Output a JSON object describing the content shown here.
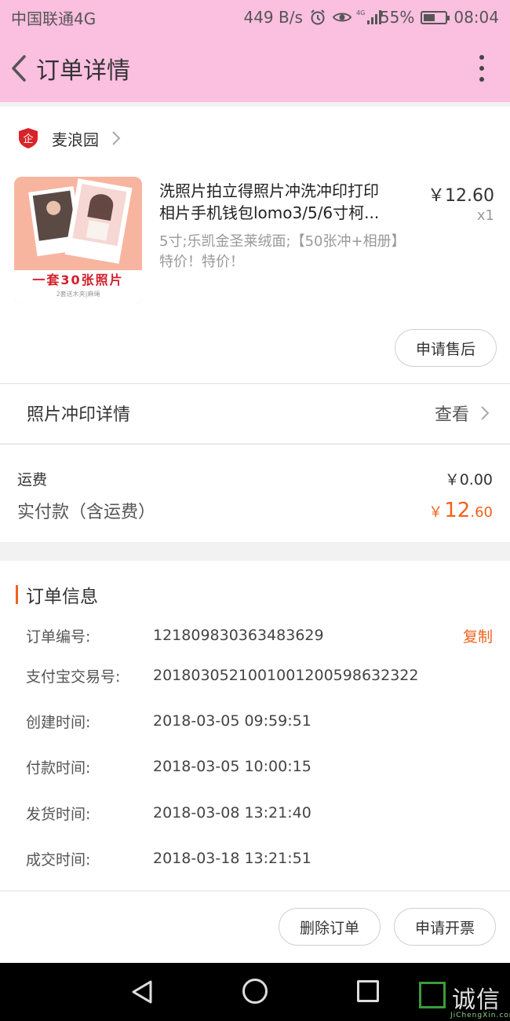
{
  "status_bar": {
    "carrier": "中国联通4G",
    "speed": "449 B/s",
    "network": "4G",
    "battery": "55%",
    "battery_level": 0.55,
    "time": "08:04"
  },
  "header": {
    "title": "订单详情"
  },
  "shop": {
    "name": "麦浪园"
  },
  "product": {
    "title_line1": "洗照片拍立得照片冲洗冲印打印",
    "title_line2": "相片手机钱包lomo3/5/6寸柯...",
    "sku": "5寸;乐凯金圣莱绒面;【50张冲+相册】特价！特价！",
    "price": "￥12.60",
    "qty": "x1",
    "thumb_banner": "一套30张照片",
    "thumb_banner_sub": "2套送木夹|麻绳",
    "after_sale_label": "申请售后"
  },
  "photo_detail": {
    "label": "照片冲印详情",
    "view_label": "查看"
  },
  "fees": {
    "shipping_label": "运费",
    "shipping_value": "￥0.00",
    "paid_label": "实付款（含运费）",
    "paid_currency": "￥",
    "paid_integer": "12",
    "paid_decimal": ".60"
  },
  "order_info": {
    "section_title": "订单信息",
    "copy_label": "复制",
    "rows": [
      {
        "label": "订单编号:",
        "value": "121809830363483629"
      },
      {
        "label": "支付宝交易号:",
        "value": "2018030521001001200598632322"
      },
      {
        "label": "创建时间:",
        "value": "2018-03-05 09:59:51"
      },
      {
        "label": "付款时间:",
        "value": "2018-03-05 10:00:15"
      },
      {
        "label": "发货时间:",
        "value": "2018-03-08 13:21:40"
      },
      {
        "label": "成交时间:",
        "value": "2018-03-18 13:21:51"
      }
    ]
  },
  "actions": {
    "delete_label": "删除订单",
    "invoice_label": "申请开票"
  },
  "watermark": {
    "text": "诚信",
    "sub": "JiChengXin.com"
  },
  "colors": {
    "header_bg": "#fbbfe0",
    "accent": "#f2611c",
    "shop_logo": "#d8232a",
    "watermark_green": "#3b9b3b"
  }
}
